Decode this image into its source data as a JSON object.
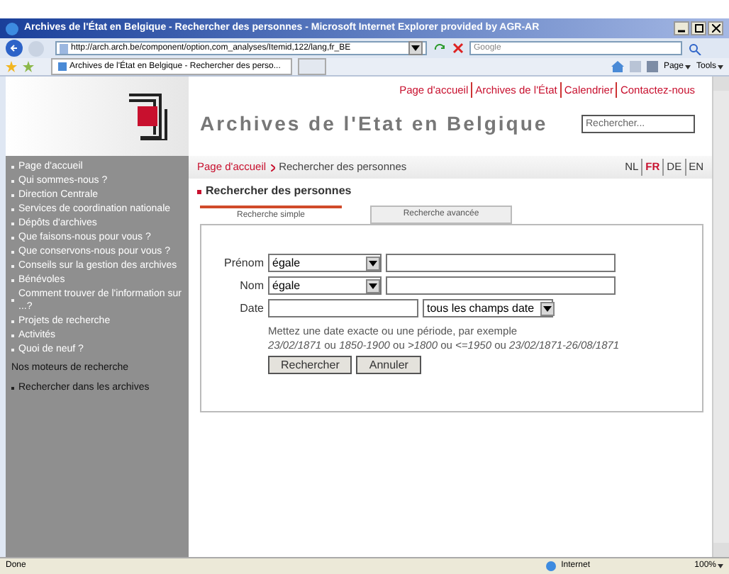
{
  "window": {
    "title": "Archives de l'État en Belgique - Rechercher des personnes - Microsoft Internet Explorer provided by AGR-AR"
  },
  "address": {
    "value": "http://arch.arch.be/component/option,com_analyses/Itemid,122/lang,fr_BE"
  },
  "search": {
    "placeholder": "Google"
  },
  "tab": {
    "title": "Archives de l'État en Belgique - Rechercher des perso..."
  },
  "command_bar": [
    "Page",
    "Tools"
  ],
  "page": {
    "top_links": [
      "Page d'accueil",
      "Archives de l'État",
      "Calendrier",
      "Contactez-nous"
    ],
    "site_title": "Archives de l'Etat en Belgique",
    "site_search": {
      "placeholder": "Rechercher..."
    },
    "sidebar": [
      {
        "label": "Page d'accueil"
      },
      {
        "label": "Qui sommes-nous ?"
      },
      {
        "label": "Direction Centrale"
      },
      {
        "label": "Services de coordination nationale"
      },
      {
        "label": "Dépôts d'archives"
      },
      {
        "label": "Que faisons-nous pour vous ?"
      },
      {
        "label": "Que conservons-nous pour vous ?"
      },
      {
        "label": "Conseils sur la gestion des archives"
      },
      {
        "label": "Bénévoles"
      },
      {
        "label": "Comment trouver de l'information sur ...?"
      },
      {
        "label": "Projets de recherche"
      },
      {
        "label": "Activités"
      },
      {
        "label": "Quoi de neuf ?"
      }
    ],
    "sidebar_heading": "Nos moteurs de recherche",
    "sidebar_sub": [
      {
        "label": "Rechercher dans les archives"
      }
    ],
    "breadcrumb": [
      "Page d'accueil",
      "Rechercher des personnes"
    ],
    "languages": [
      {
        "label": "NL",
        "selected": false
      },
      {
        "label": "FR",
        "selected": true
      },
      {
        "label": "DE",
        "selected": false
      },
      {
        "label": "EN",
        "selected": false
      }
    ],
    "heading": "Rechercher des personnes",
    "tabs": [
      {
        "label": "Recherche simple",
        "selected": true
      },
      {
        "label": "Recherche avancée",
        "selected": false
      }
    ],
    "fields": [
      {
        "label": "Prénom",
        "kind": "name",
        "operator": "égale"
      },
      {
        "label": "Nom",
        "kind": "name",
        "operator": "égale"
      },
      {
        "label": "Date",
        "kind": "date",
        "operator": "tous les champs date"
      }
    ],
    "hint": "Mettez une date exacte ou une période, par exemple",
    "examples": "*23/02/1871* ou *1850-1900* ou *>1800* ou *<=1950* ou *23/02/1871-26/08/1871*",
    "buttons": [
      "Rechercher",
      "Annuler"
    ]
  },
  "status_bar": {
    "text": "Done",
    "zone": "Internet",
    "zoom": "100%"
  }
}
